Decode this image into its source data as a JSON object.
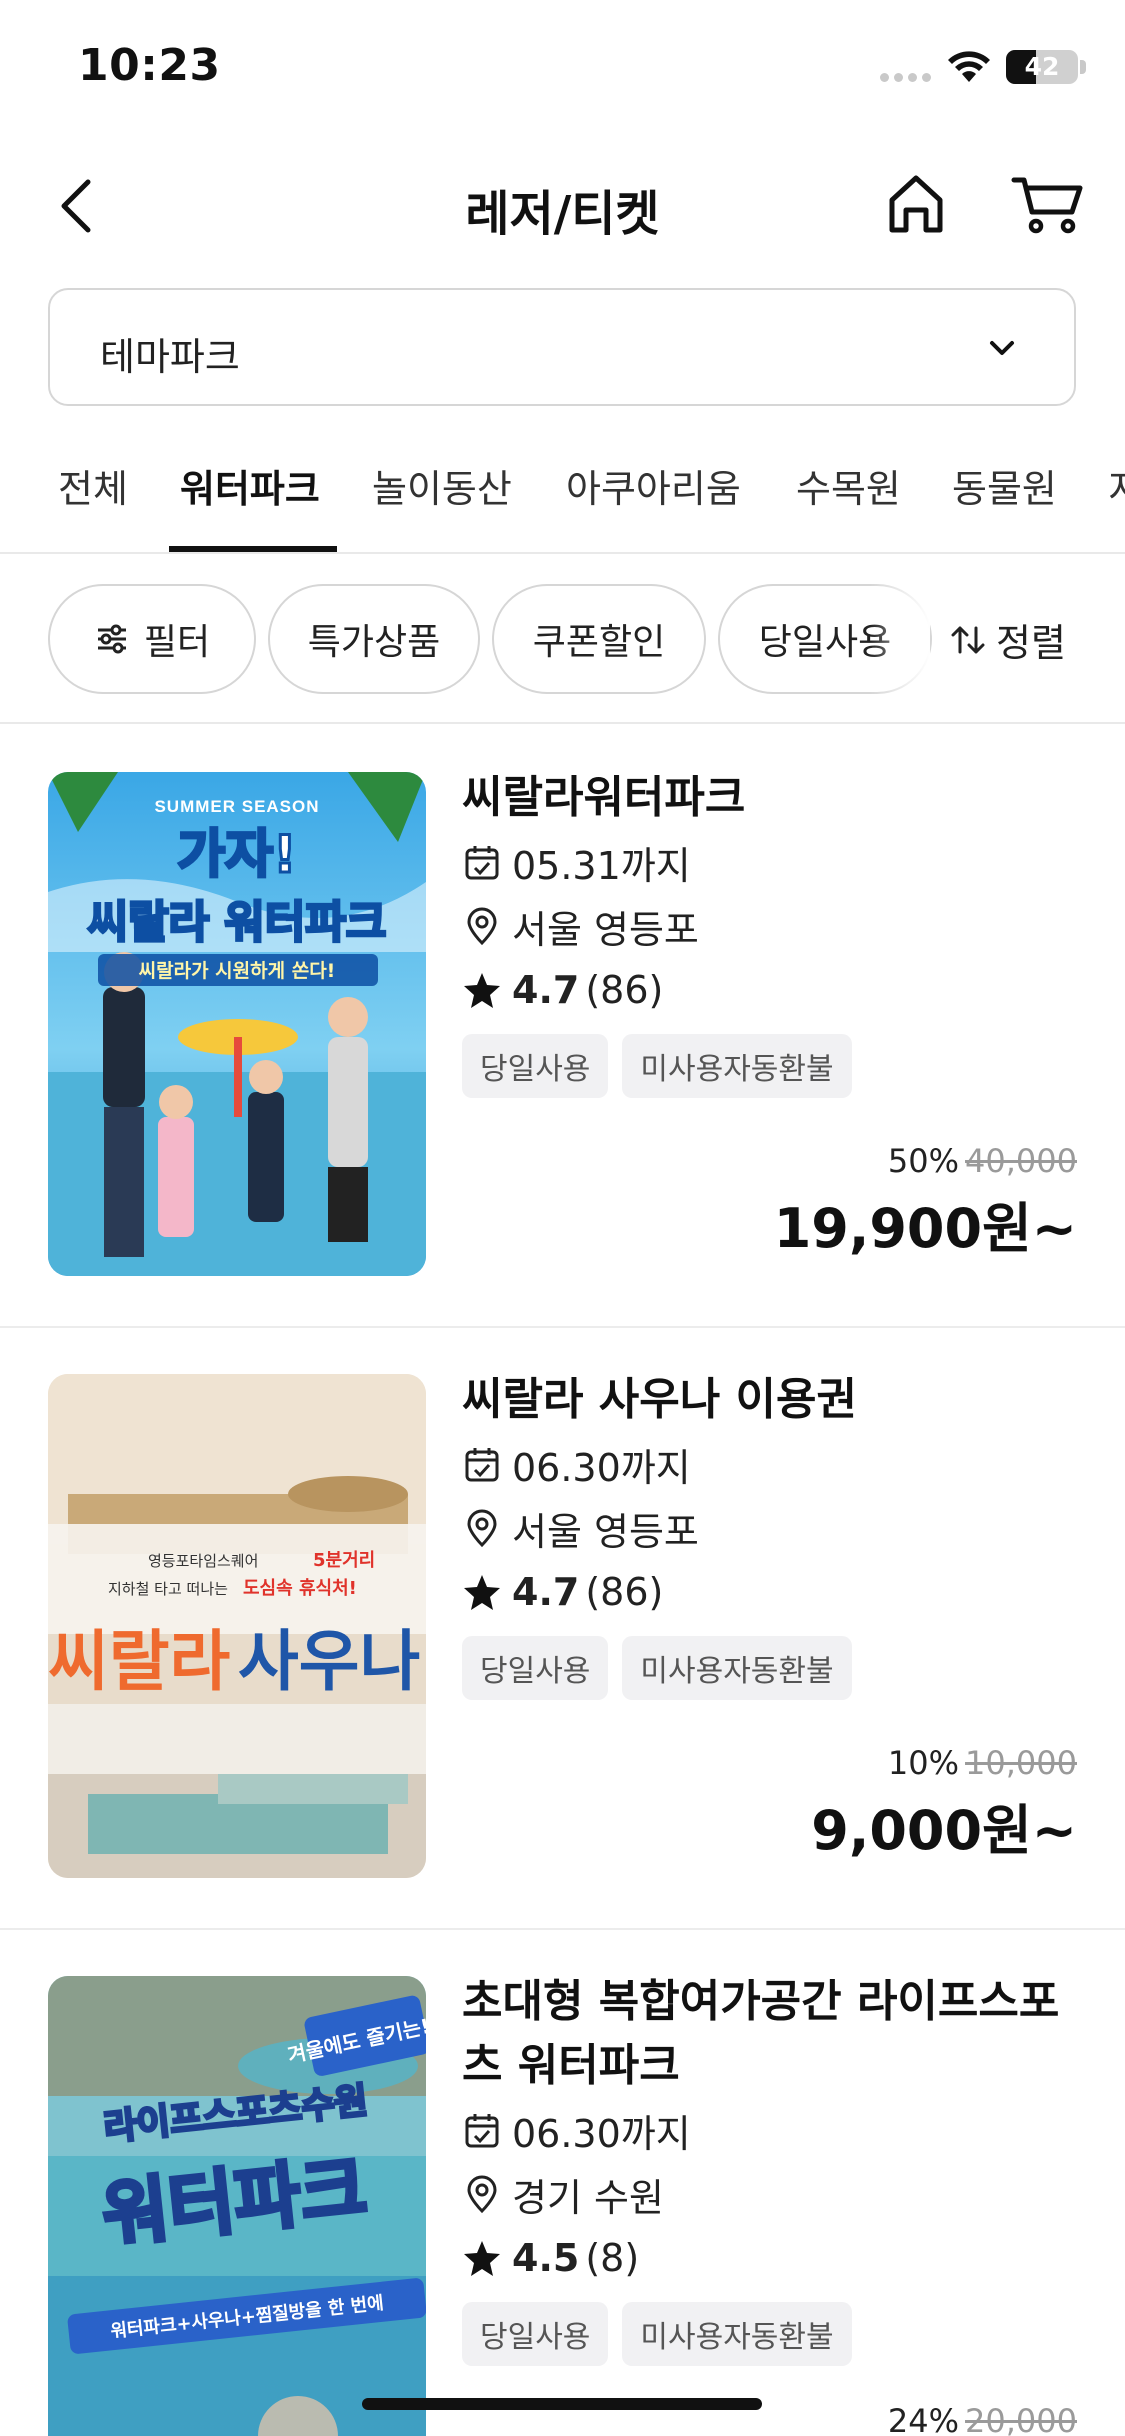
{
  "status_bar": {
    "time": "10:23",
    "battery": "42",
    "battery_level": 0.42
  },
  "header": {
    "title": "레저/티켓"
  },
  "category_select": {
    "value": "테마파크"
  },
  "tabs": [
    {
      "label": "전체",
      "active": false
    },
    {
      "label": "워터파크",
      "active": true
    },
    {
      "label": "놀이동산",
      "active": false
    },
    {
      "label": "아쿠아리움",
      "active": false
    },
    {
      "label": "수목원",
      "active": false
    },
    {
      "label": "동물원",
      "active": false
    },
    {
      "label": "지",
      "active": false
    }
  ],
  "filters": {
    "filter_label": "필터",
    "chips": [
      "특가상품",
      "쿠폰할인",
      "당일사용"
    ],
    "sort_label": "정렬"
  },
  "products": [
    {
      "name": "씨랄라워터파크",
      "date": "05.31까지",
      "location": "서울 영등포",
      "rating": "4.7",
      "reviews": "(86)",
      "tags": [
        "당일사용",
        "미사용자동환불"
      ],
      "discount": "50%",
      "original_price": "40,000",
      "price": "19,900원~",
      "image": {
        "season": "SUMMER SEASON",
        "headline": "가자!",
        "subhead": "씨랄라 워터파크",
        "tagline": "씨랄라가 시원하게 쏜다!"
      }
    },
    {
      "name": "씨랄라 사우나 이용권",
      "date": "06.30까지",
      "location": "서울 영등포",
      "rating": "4.7",
      "reviews": "(86)",
      "tags": [
        "당일사용",
        "미사용자동환불"
      ],
      "discount": "10%",
      "original_price": "10,000",
      "price": "9,000원~",
      "image": {
        "line1_a": "영등포타임스퀘어",
        "line1_b": "5분거리",
        "line2_a": "지하철 타고 떠나는",
        "line2_b": "도심속 휴식처!",
        "brand_a": "씨랄라",
        "brand_b": "사우나"
      }
    },
    {
      "name": "초대형 복합여가공간 라이프스포츠 워터파크",
      "date": "06.30까지",
      "location": "경기 수원",
      "rating": "4.5",
      "reviews": "(8)",
      "tags": [
        "당일사용",
        "미사용자동환불"
      ],
      "discount": "24%",
      "original_price": "20,000",
      "price": "",
      "image": {
        "badge": "겨울에도 즐기는!",
        "line1": "라이프스포츠수원",
        "line2": "워터파크",
        "line3": "워터파크+사우나+찜질방을 한 번에"
      }
    }
  ]
}
